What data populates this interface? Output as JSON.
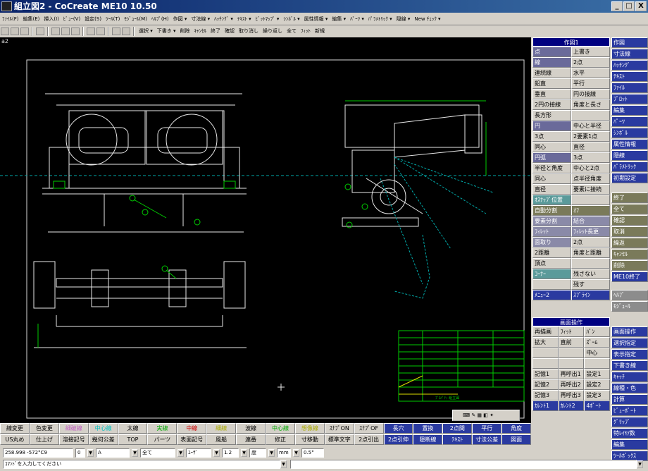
{
  "window": {
    "title": "組立図2 - CoCreate ME10 10.50",
    "min": "_",
    "max": "□",
    "close": "X"
  },
  "menu": [
    "ﾌｧｲﾙ(F)",
    "編集(E)",
    "挿入(I)",
    "ﾋﾞｭｰ(V)",
    "設定(S)",
    "ﾂｰﾙ(T)",
    "ﾓｼﾞｭｰﾙ(M)",
    "ﾍﾙﾌﾟ(H)",
    "作図 ▾",
    "寸法線 ▾",
    "ﾊｯﾁﾝｸﾞ ▾",
    "ﾃｷｽﾄ ▾",
    "ﾋﾞｯﾄﾏｯﾌﾟ ▾",
    "ｼﾝﾎﾞﾙ ▾",
    "属性情報 ▾",
    "編集 ▾",
    "ﾊﾟｰﾂ ▾",
    "ﾊﾟﾗﾒﾄﾘｯｸ ▾",
    "隠線 ▾",
    "New ﾁｪｯｸ ▾"
  ],
  "toolbar_text": [
    "選択 ▾",
    "下書き ▾",
    "削除",
    "ｷｬﾝｾﾙ",
    "終了",
    "確認",
    "取り消し",
    "繰り返し",
    "全て",
    "ﾌｨｯﾄ",
    "新規"
  ],
  "viewport_label": "a2",
  "panel": {
    "header": "作図1",
    "rows": [
      [
        "点",
        "上書き"
      ],
      [
        "線",
        "2点"
      ],
      [
        "連続線",
        "水平"
      ],
      [
        "鉛直",
        "平行"
      ],
      [
        "垂直",
        "円の接線"
      ],
      [
        "2円の接線",
        "角度と長さ"
      ],
      [
        "長方形",
        ""
      ],
      [
        "円",
        "中心と半径"
      ],
      [
        "3点",
        "2要素1点"
      ],
      [
        "同心",
        "直径"
      ],
      [
        "円弧",
        "3点"
      ],
      [
        "半径と角度",
        "中心と2点"
      ],
      [
        "同心",
        "点半径角度"
      ],
      [
        "直径",
        "要素に接続"
      ],
      [
        "ｵｽﾅｯﾌﾟ位置",
        ""
      ],
      [
        "自動分割",
        "ｵﾌ"
      ],
      [
        "要素分割",
        "結合"
      ],
      [
        "ﾌｨﾚｯﾄ",
        "ﾌｨﾚｯﾄ長更"
      ],
      [
        "面取り",
        "2点"
      ],
      [
        "2距離",
        "角度と距離"
      ],
      [
        "頂点",
        ""
      ],
      [
        "ｺｰﾅｰ",
        "残さない"
      ],
      [
        "",
        "残す"
      ],
      [
        "ﾒﾆｭｰ2",
        "ｽﾌﾟﾗｲﾝ"
      ]
    ],
    "header2": "画面操作",
    "rows2": [
      [
        "再描画",
        "ﾌｨｯﾄ",
        "ﾊﾟﾝ"
      ],
      [
        "拡大",
        "直前",
        "ｽﾞｰﾑ"
      ],
      [
        "",
        "",
        "中心"
      ],
      [
        "",
        "",
        ""
      ],
      [
        "記憶1",
        "再呼出1",
        "設定1"
      ],
      [
        "記憶2",
        "再呼出2",
        "設定2"
      ],
      [
        "記憶3",
        "再呼出3",
        "設定3"
      ],
      [
        "ｶﾚﾝﾄ1",
        "ｶﾚﾝﾄ2",
        "4ﾎﾟｰﾄ"
      ]
    ]
  },
  "panel2": {
    "top": [
      "作図",
      "寸法線",
      "ﾊｯﾁﾝｸﾞ",
      "ﾃｷｽﾄ",
      "ﾌｧｲﾙ",
      "ﾌﾟﾛｯﾄ",
      "編集",
      "ﾊﾟｰﾂ",
      "ｼﾝﾎﾞﾙ",
      "属性情報",
      "隠線",
      "ﾊﾟﾗﾒﾄﾘｯｸ",
      "初期設定"
    ],
    "mid": [
      "終了",
      "全て",
      "確認",
      "取消",
      "繰返",
      "ｷｬﾝｾﾙ",
      "削除",
      "ME10終了"
    ],
    "low": [
      "ﾍﾙﾌﾟ",
      "ﾓｼﾞｭｰﾙ"
    ],
    "bot": [
      "画面操作",
      "選択指定",
      "表示指定",
      "下書き線",
      "ｷｬｯﾁ",
      "線種・色",
      "計算",
      "ﾋﾞｭｰﾎﾟｰﾄ",
      "ｸﾞﾘｯﾌﾟ",
      "特ﾚｲﾔ/数",
      "編集",
      "ﾂｰﾙﾎﾞｯｸｽ"
    ]
  },
  "bottom_rows": [
    [
      "線変更",
      "色変更",
      "細破線",
      "中心線",
      "太線",
      "実線",
      "中線",
      "細線",
      "波線",
      "中心線",
      "想像線",
      "ｽﾅﾌﾟON",
      "ｽﾅﾌﾟOF",
      "長穴",
      "置換",
      "2点間",
      "平行",
      "角度"
    ],
    [
      "US丸め",
      "仕上げ",
      "溶接記号",
      "幾何公差",
      "TOP",
      "パーツ",
      "表面記号",
      "風船",
      "連番",
      "修正",
      "寸移動",
      "標準文字",
      "2点引出",
      "2点引伸",
      "隠断線",
      "ﾃｷｽﾄ",
      "寸法公差",
      "図面"
    ]
  ],
  "status": {
    "coord": "258.998 -572°C9",
    "layer": "0",
    "linetype": "A",
    "scope": "全て",
    "user": "ﾕｰｻﾞ",
    "scale": "1.2",
    "wrap": "度",
    "unit": "mm",
    "angle": "0.5°"
  },
  "command_prompt": "ｺﾏﾝﾄﾞを入力してください",
  "titleblock_caption": "ﾌﾟﾛﾊﾟﾃｨ 組立図",
  "colors": {
    "canvas": "#000000",
    "line": "#e8e8e8",
    "green": "#00cc00",
    "cyan": "#00aaaa",
    "yellow": "#dddd00",
    "title_bar": "#0a246a",
    "menu_blue": "#2a3aa0"
  }
}
